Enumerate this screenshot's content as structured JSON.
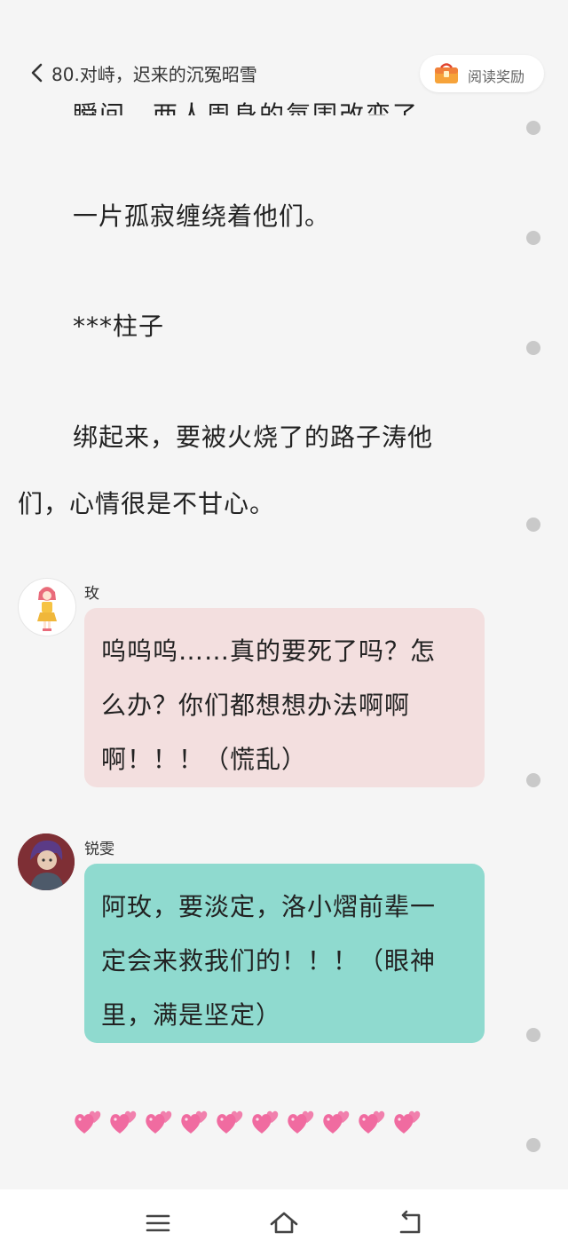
{
  "header": {
    "chapter_title": "80.对峙，迟来的沉冤昭雪",
    "reward_label": "阅读奖励"
  },
  "story": {
    "clipped_line": "瞬间，两人周身的氛围改变了。",
    "paragraphs": [
      "一片孤寂缠绕着他们。",
      "***柱子",
      "绑起来，要被火烧了的路子涛他",
      "们，心情很是不甘心。"
    ]
  },
  "dialogue": [
    {
      "speaker": "玫",
      "lines": [
        "呜呜呜……真的要死了吗？怎",
        "么办？你们都想想办法啊啊",
        "啊！！！（慌乱）"
      ]
    },
    {
      "speaker": "锐雯",
      "lines": [
        "阿玫，要淡定，洛小熠前辈一",
        "定会来救我们的！！！（眼神",
        "里，满是坚定）"
      ]
    }
  ],
  "emoji_line": {
    "icon": "two-hearts-icon",
    "count": 10
  },
  "colors": {
    "background": "#f5f5f5",
    "pink_bubble": "#f3dfdf",
    "teal_bubble": "#8fdacf",
    "heart": "#f06ba0"
  },
  "nav": {
    "menu_icon": "menu-icon",
    "home_icon": "home-icon",
    "back_icon": "back-icon"
  }
}
